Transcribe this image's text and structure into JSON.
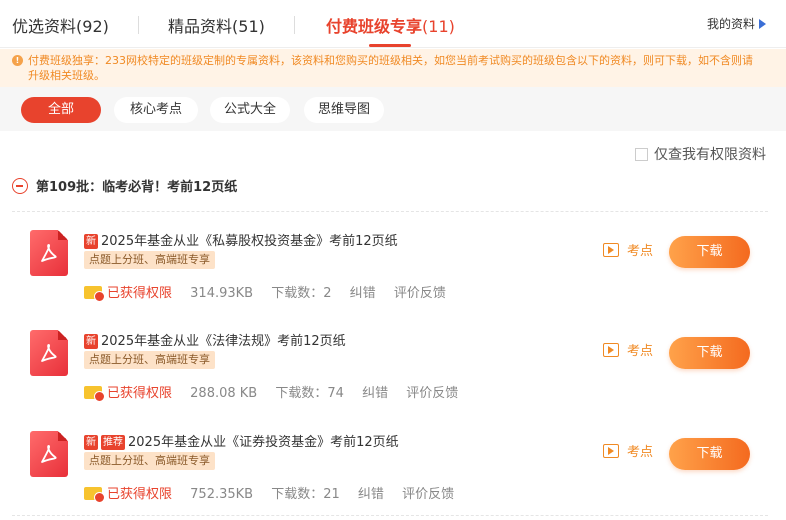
{
  "tabs": [
    {
      "label": "优选资料",
      "count": "(92)"
    },
    {
      "label": "精品资料",
      "count": "(51)"
    },
    {
      "label": "付费班级专享",
      "count": "(11)"
    }
  ],
  "active_tab": "付费班级专享",
  "my_docs": "我的资料",
  "notice": "付费班级独享：233网校特定的班级定制的专属资料，该资料和您购买的班级相关，如您当前考试购买的班级包含以下的资料，则可下载，如不含则请升级相关班级。",
  "filters": [
    "全部",
    "核心考点",
    "公式大全",
    "思维导图"
  ],
  "active_filter": "全部",
  "permission_filter": "仅查我有权限资料",
  "batch_title": "第109批：临考必背！考前12页纸",
  "documents": [
    {
      "tags": [
        "新"
      ],
      "title": "2025年基金从业《私募股权投资基金》考前12页纸",
      "badge": "点题上分班、高端班专享",
      "access": "已获得权限",
      "size": "314.93KB",
      "downloads": "下载数：2",
      "report": "纠错",
      "feedback": "评价反馈",
      "keypoint": "考点",
      "download": "下载"
    },
    {
      "tags": [
        "新"
      ],
      "title": "2025年基金从业《法律法规》考前12页纸",
      "badge": "点题上分班、高端班专享",
      "access": "已获得权限",
      "size": "288.08 KB",
      "downloads": "下载数：74",
      "report": "纠错",
      "feedback": "评价反馈",
      "keypoint": "考点",
      "download": "下载"
    },
    {
      "tags": [
        "新",
        "推荐"
      ],
      "title": "2025年基金从业《证券投资基金》考前12页纸",
      "badge": "点题上分班、高端班专享",
      "access": "已获得权限",
      "size": "752.35KB",
      "downloads": "下载数：21",
      "report": "纠错",
      "feedback": "评价反馈",
      "keypoint": "考点",
      "download": "下载"
    }
  ],
  "colors": {
    "accent": "#e8432d",
    "orange": "#f08a24",
    "notice_bg": "#fff3e6"
  }
}
